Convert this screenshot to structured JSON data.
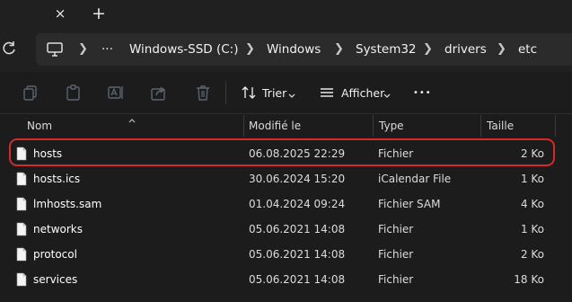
{
  "titlebar": {
    "close_icon": "×",
    "new_tab_icon": "+"
  },
  "address": {
    "breadcrumbs": [
      "Windows-SSD (C:)",
      "Windows",
      "System32",
      "drivers",
      "etc"
    ],
    "more": "···"
  },
  "toolbar": {
    "sort_label": "Trier",
    "view_label": "Afficher",
    "more": "•••"
  },
  "columns": {
    "name": "Nom",
    "modified": "Modifié le",
    "type": "Type",
    "size": "Taille"
  },
  "files": [
    {
      "name": "hosts",
      "modified": "06.08.2025 22:29",
      "type": "Fichier",
      "size": "2 Ko",
      "highlighted": true
    },
    {
      "name": "hosts.ics",
      "modified": "30.06.2024 15:20",
      "type": "iCalendar File",
      "size": "1 Ko"
    },
    {
      "name": "lmhosts.sam",
      "modified": "01.04.2024 09:24",
      "type": "Fichier SAM",
      "size": "4 Ko"
    },
    {
      "name": "networks",
      "modified": "05.06.2021 14:08",
      "type": "Fichier",
      "size": "1 Ko"
    },
    {
      "name": "protocol",
      "modified": "05.06.2021 14:08",
      "type": "Fichier",
      "size": "2 Ko"
    },
    {
      "name": "services",
      "modified": "05.06.2021 14:08",
      "type": "Fichier",
      "size": "18 Ko"
    }
  ],
  "colors": {
    "highlight_border": "#d42a2a",
    "background": "#1c1c1c"
  }
}
